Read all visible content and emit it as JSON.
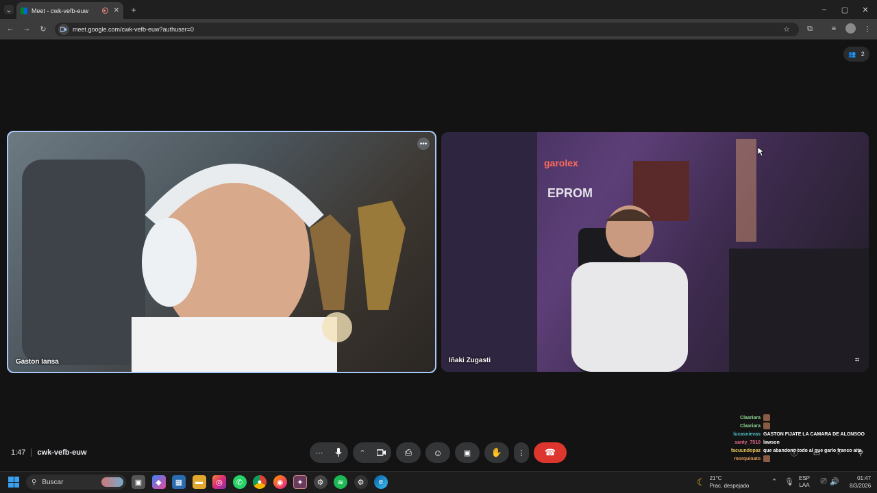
{
  "browser": {
    "tab_title": "Meet - cwk-vefb-euw",
    "url": "meet.google.com/cwk-vefb-euw?authuser=0",
    "new_tab_icon": "plus-icon"
  },
  "meet": {
    "participants_count": "2",
    "tiles": [
      {
        "name": "Gaston Iansa"
      },
      {
        "name": "Iñaki Zugasti"
      }
    ],
    "time": "1:47",
    "meeting_code": "cwk-vefb-euw"
  },
  "chat_overlay": [
    {
      "user": "Claariara",
      "text": "",
      "color": "#8fd18f"
    },
    {
      "user": "Claariara",
      "text": "",
      "color": "#8fd18f"
    },
    {
      "user": "lucasnievas",
      "text": "GASTON FIJATE LA CAMARA DE ALONSOO",
      "color": "#4fc3c7"
    },
    {
      "user": "santy_7510",
      "text": "lawson",
      "color": "#e86a8a"
    },
    {
      "user": "facuundopaz",
      "text": "que abandono todo al que garlo franco aita",
      "color": "#e8c35a"
    },
    {
      "user": "morquinato",
      "text": "",
      "color": "#e8a05a"
    }
  ],
  "taskbar": {
    "search_placeholder": "Buscar",
    "weather_temp": "21°C",
    "weather_desc": "Prac. despejado",
    "lang": "ESP",
    "lang_sub": "LAA",
    "clock_time": "01:47",
    "clock_date": "8/3/2026"
  },
  "colors": {
    "active_border": "#a8c7fa",
    "end_call": "#dc362e",
    "bg": "#131314"
  }
}
